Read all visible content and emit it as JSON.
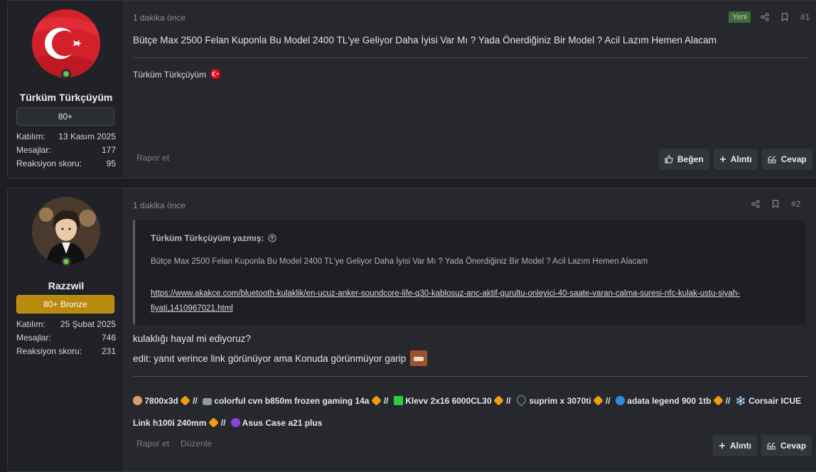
{
  "posts": [
    {
      "user": {
        "name": "Türküm Türkçüyüm",
        "rank": "80+",
        "stats": [
          {
            "label": "Katılım:",
            "value": "13 Kasım 2025"
          },
          {
            "label": "Mesajlar:",
            "value": "177"
          },
          {
            "label": "Reaksiyon skoru:",
            "value": "95"
          }
        ]
      },
      "time": "1 dakika önce",
      "new_badge": "Yeni",
      "number": "#1",
      "content": "Bütçe Max 2500 Felan Kuponla Bu Model 2400 TL'ye Geliyor Daha İyisi Var Mı ? Yada Önerdiğiniz Bir Model ? Acil Lazım Hemen Alacam",
      "signature": "Türküm Türkçüyüm",
      "report": "Rapor et",
      "actions": {
        "like": "Beğen",
        "quote": "Alıntı",
        "reply": "Cevap"
      }
    },
    {
      "user": {
        "name": "Razzwil",
        "rank": "80+ Bronze",
        "stats": [
          {
            "label": "Katılım:",
            "value": "25 Şubat 2025"
          },
          {
            "label": "Mesajlar:",
            "value": "746"
          },
          {
            "label": "Reaksiyon skoru:",
            "value": "231"
          }
        ]
      },
      "time": "1 dakika önce",
      "number": "#2",
      "quote": {
        "author": "Türküm Türkçüyüm yazmış:",
        "text": "Bütçe Max 2500 Felan Kuponla Bu Model 2400 TL'ye Geliyor Daha İyisi Var Mı ? Yada Önerdiğiniz Bir Model ? Acil Lazım Hemen Alacam",
        "link": "https://www.akakce.com/bluetooth-kulaklik/en-ucuz-anker-soundcore-life-q30-kablosuz-anc-aktif-gurultu-onleyici-40-saate-varan-calma-suresi-nfc-kulak-ustu-siyah-fiyati,1410967021.html"
      },
      "line1": "kulaklığı hayal mi ediyoruz?",
      "line2": "edit: yanıt verince link görünüyor ama Konuda görünmüyor garip",
      "specs": [
        "7800x3d",
        "colorful cvn b850m frozen gaming 14a",
        "Klevv 2x16 6000CL30",
        "suprim x 3070ti",
        "adata legend 900 1tb",
        "Corsair ICUE Link h100i 240mm",
        "Asus Case a21 plus"
      ],
      "separator": "//",
      "report": "Rapor et",
      "edit": "Düzenle",
      "actions": {
        "quote": "Alıntı",
        "reply": "Cevap"
      }
    }
  ],
  "colors": {
    "accent_gold": "#b88a0e",
    "online": "#6fbf4c",
    "new_badge": "#3f6b3a"
  }
}
